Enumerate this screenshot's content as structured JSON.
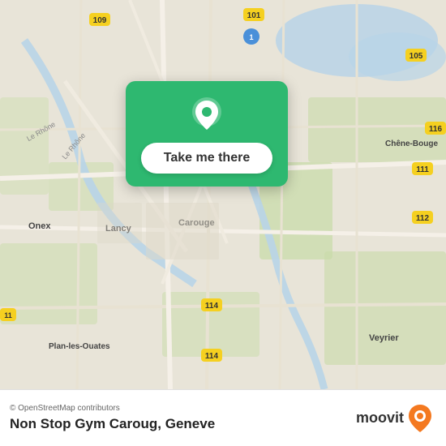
{
  "map": {
    "alt": "Map of Carouge, Geneve area"
  },
  "card": {
    "button_label": "Take me there"
  },
  "bottom_bar": {
    "osm_credit": "© OpenStreetMap contributors",
    "place_name": "Non Stop Gym Caroug, Geneve",
    "moovit_label": "moovit"
  }
}
